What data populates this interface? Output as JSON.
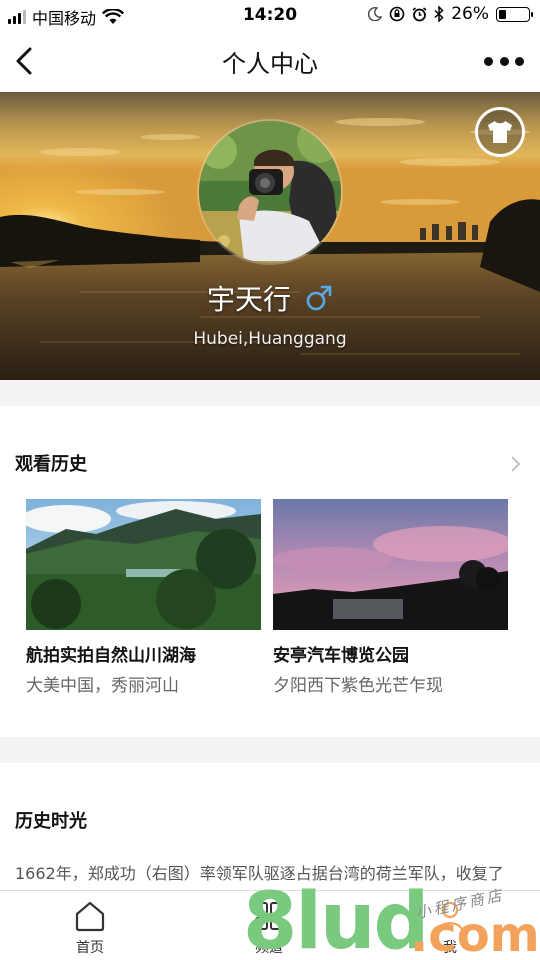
{
  "status_bar": {
    "carrier": "中国移动",
    "time": "14:20",
    "battery_percent": "26%",
    "battery_level": 0.26,
    "icons": [
      "signal-icon",
      "wifi-icon",
      "moon-icon",
      "rotation-lock-icon",
      "alarm-icon",
      "bluetooth-icon",
      "battery-icon"
    ]
  },
  "nav": {
    "title": "个人中心",
    "back_icon": "back-arrow-icon",
    "more_icon": "more-dots-icon"
  },
  "profile": {
    "username": "宇天行",
    "gender_symbol": "♂",
    "location": "Hubei,Huanggang",
    "shirt_icon": "tshirt-icon",
    "accent_color": "#5aa9e6"
  },
  "watch_history": {
    "title": "观看历史",
    "items": [
      {
        "title": "航拍实拍自然山川湖海",
        "subtitle": "大美中国，秀丽河山"
      },
      {
        "title": "安亭汽车博览公园",
        "subtitle": "夕阳西下紫色光芒乍现"
      }
    ]
  },
  "history_time": {
    "title": "历史时光",
    "text": "1662年，郑成功（右图）率领军队驱逐占据台湾的荷兰军队，收复了"
  },
  "tabbar": {
    "tabs": [
      {
        "label": "首页",
        "icon": "home-icon"
      },
      {
        "label": "频道",
        "icon": "channel-grid-icon"
      },
      {
        "label": "我",
        "icon": "me-person-icon"
      }
    ]
  },
  "watermark": {
    "brand": "8lud",
    "suffix": ".com",
    "script": "小程序商店"
  }
}
